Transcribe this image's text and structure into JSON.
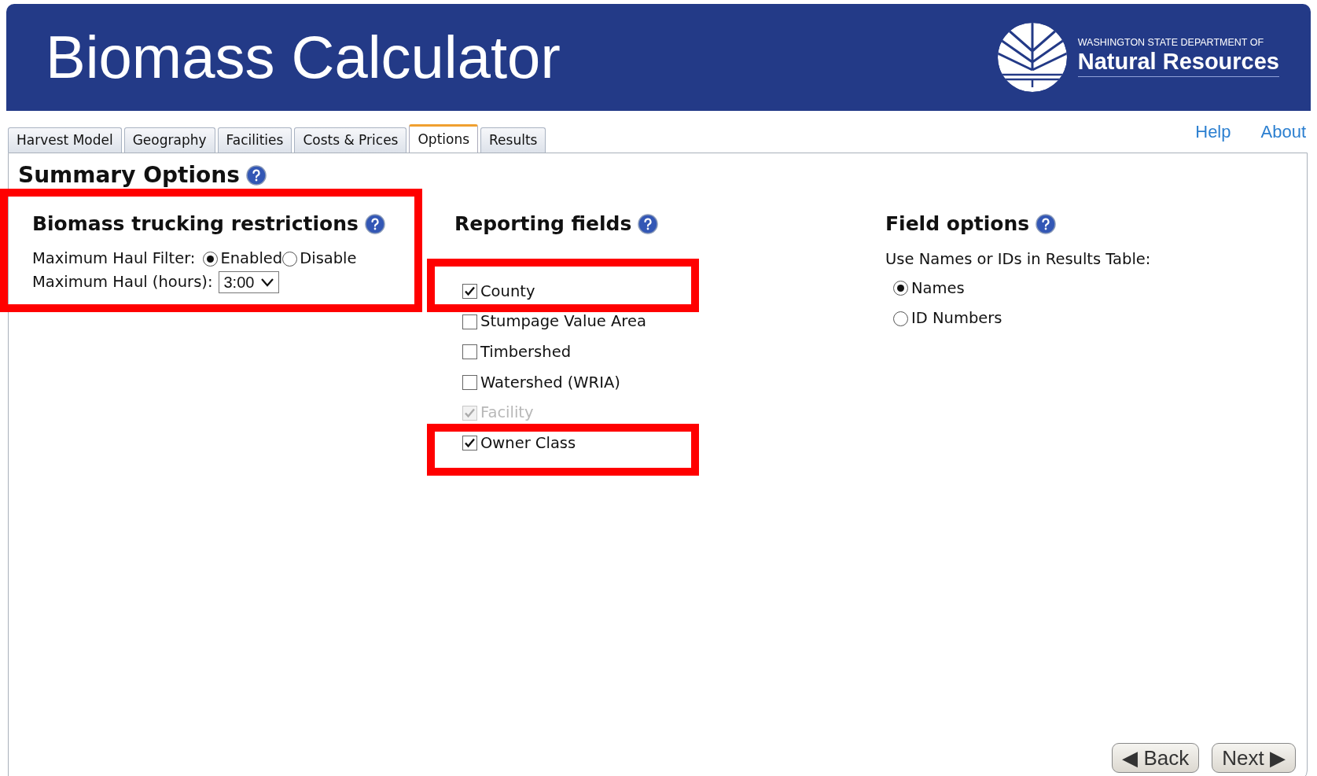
{
  "header": {
    "title": "Biomass Calculator",
    "logo_small": "WASHINGTON STATE DEPARTMENT OF",
    "logo_large": "Natural Resources"
  },
  "tabs": [
    {
      "label": "Harvest Model",
      "selected": false
    },
    {
      "label": "Geography",
      "selected": false
    },
    {
      "label": "Facilities",
      "selected": false
    },
    {
      "label": "Costs & Prices",
      "selected": false
    },
    {
      "label": "Options",
      "selected": true
    },
    {
      "label": "Results",
      "selected": false
    }
  ],
  "links": [
    "Help",
    "About"
  ],
  "page_title": "Summary Options",
  "trucking": {
    "heading": "Biomass trucking restrictions",
    "filter_label": "Maximum Haul Filter:",
    "filter_options": [
      {
        "label": "Enabled",
        "selected": true
      },
      {
        "label": "Disable",
        "selected": false
      }
    ],
    "hours_label": "Maximum Haul (hours):",
    "hours_value": "3:00"
  },
  "reporting": {
    "heading": "Reporting fields",
    "fields": [
      {
        "label": "County",
        "checked": true,
        "disabled": false
      },
      {
        "label": "Stumpage Value Area",
        "checked": false,
        "disabled": false
      },
      {
        "label": "Timbershed",
        "checked": false,
        "disabled": false
      },
      {
        "label": "Watershed (WRIA)",
        "checked": false,
        "disabled": false
      },
      {
        "label": "Facility",
        "checked": true,
        "disabled": true
      },
      {
        "label": "Owner Class",
        "checked": true,
        "disabled": false
      }
    ]
  },
  "field_options": {
    "heading": "Field options",
    "prompt": "Use Names or IDs in Results Table:",
    "choices": [
      {
        "label": "Names",
        "selected": true
      },
      {
        "label": "ID Numbers",
        "selected": false
      }
    ]
  },
  "buttons": [
    "◀ Back",
    "Next ▶"
  ]
}
